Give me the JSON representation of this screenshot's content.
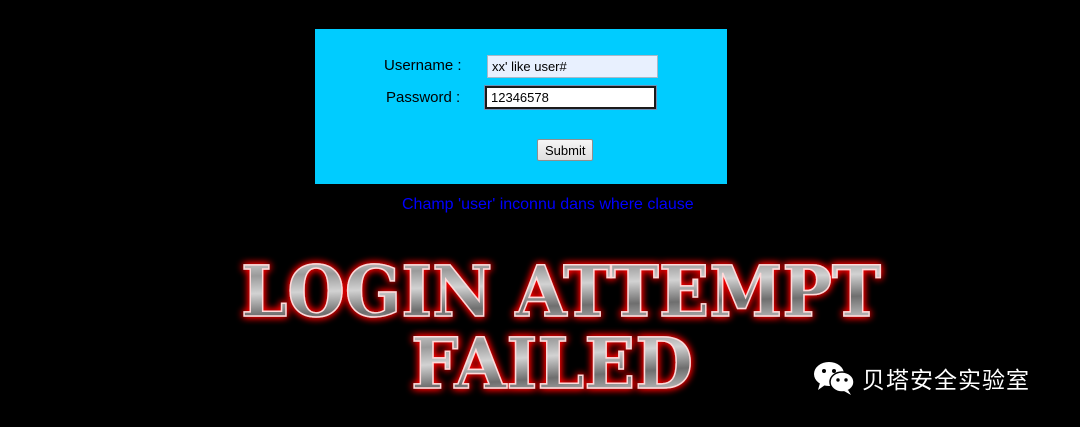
{
  "login_form": {
    "username_label": "Username :",
    "username_value": "xx' like user#",
    "password_label": "Password :",
    "password_value": "12346578",
    "submit_label": "Submit"
  },
  "error_message": "Champ 'user' inconnu dans where clause",
  "banner": {
    "line1": "LOGIN ATTEMPT",
    "line2": "FAILED"
  },
  "watermark": {
    "icon": "wechat-icon",
    "text": "贝塔安全实验室"
  },
  "colors": {
    "background": "#000000",
    "panel": "#00ccff",
    "error_text": "#0000ff",
    "banner_glow": "#ff0000"
  }
}
